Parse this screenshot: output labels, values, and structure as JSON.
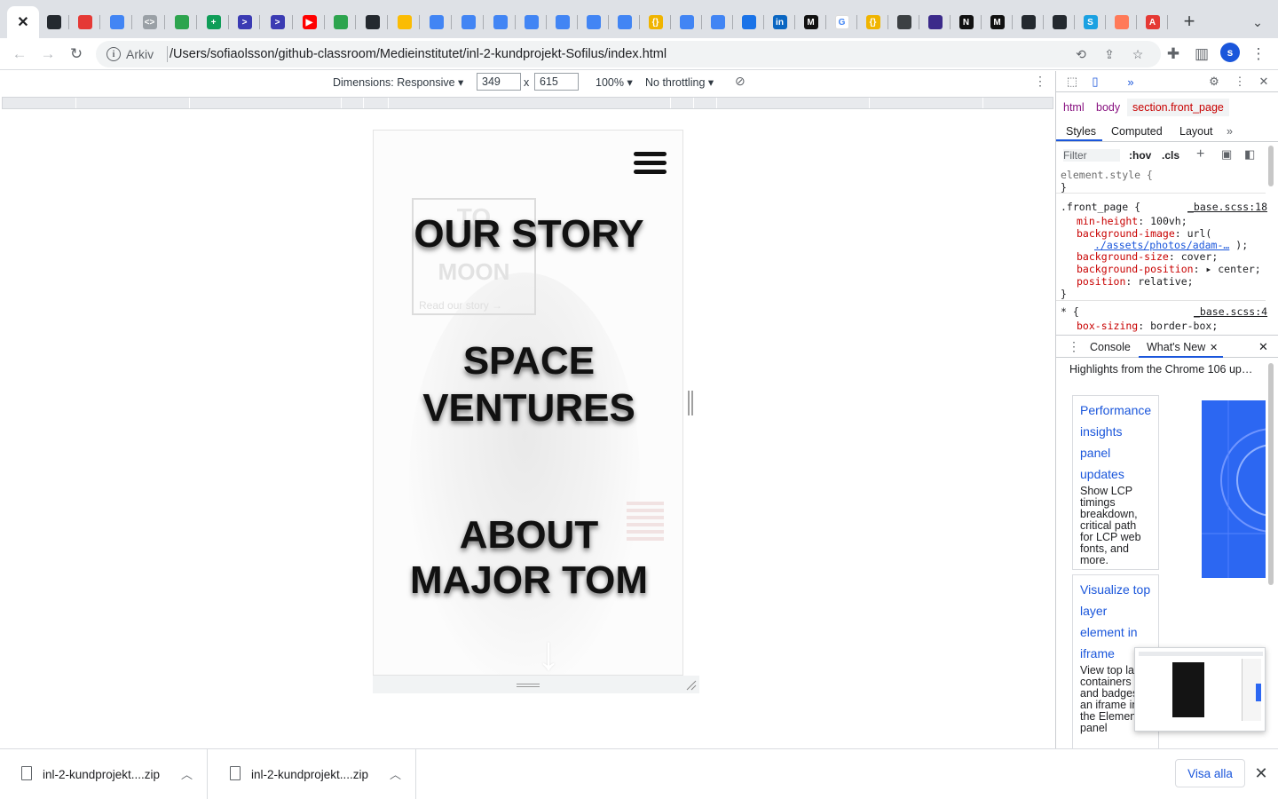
{
  "tabs": {
    "active_close": "✕",
    "favicons": [
      {
        "name": "github-icon",
        "color": "#24292f",
        "glyph": ""
      },
      {
        "name": "pin-icon",
        "color": "#e53935",
        "glyph": ""
      },
      {
        "name": "docs-icon",
        "color": "#4285f4",
        "glyph": ""
      },
      {
        "name": "code-icon",
        "color": "#9aa0a6",
        "glyph": "<>"
      },
      {
        "name": "github-icon",
        "color": "#2da44e",
        "glyph": ""
      },
      {
        "name": "sheets-icon",
        "color": "#0f9d58",
        "glyph": "+"
      },
      {
        "name": "prompt-icon",
        "color": "#3b3bb3",
        "glyph": ">"
      },
      {
        "name": "prompt-icon",
        "color": "#3b3bb3",
        "glyph": ">"
      },
      {
        "name": "youtube-icon",
        "color": "#ff0000",
        "glyph": "▶"
      },
      {
        "name": "github-icon",
        "color": "#2da44e",
        "glyph": ""
      },
      {
        "name": "github-icon",
        "color": "#24292f",
        "glyph": ""
      },
      {
        "name": "drive-icon",
        "color": "#fbbc04",
        "glyph": ""
      },
      {
        "name": "docs-icon",
        "color": "#4285f4",
        "glyph": ""
      },
      {
        "name": "docs-icon",
        "color": "#4285f4",
        "glyph": ""
      },
      {
        "name": "docs-icon",
        "color": "#4285f4",
        "glyph": ""
      },
      {
        "name": "docs-icon",
        "color": "#4285f4",
        "glyph": ""
      },
      {
        "name": "docs-icon",
        "color": "#4285f4",
        "glyph": ""
      },
      {
        "name": "docs-icon",
        "color": "#4285f4",
        "glyph": ""
      },
      {
        "name": "docs-icon",
        "color": "#4285f4",
        "glyph": ""
      },
      {
        "name": "json-icon",
        "color": "#f0b400",
        "glyph": "{}"
      },
      {
        "name": "docs-icon",
        "color": "#4285f4",
        "glyph": ""
      },
      {
        "name": "docs-icon",
        "color": "#4285f4",
        "glyph": ""
      },
      {
        "name": "window-icon",
        "color": "#1a73e8",
        "glyph": ""
      },
      {
        "name": "linkedin-icon",
        "color": "#0a66c2",
        "glyph": "in"
      },
      {
        "name": "medium-icon",
        "color": "#111111",
        "glyph": "M"
      },
      {
        "name": "google-icon",
        "color": "#ffffff",
        "glyph": "G"
      },
      {
        "name": "json-icon",
        "color": "#f0b400",
        "glyph": "{}"
      },
      {
        "name": "eraser-icon",
        "color": "#3c4043",
        "glyph": ""
      },
      {
        "name": "mascot-icon",
        "color": "#3b2a8a",
        "glyph": ""
      },
      {
        "name": "notion-icon",
        "color": "#111111",
        "glyph": "N"
      },
      {
        "name": "medium-icon",
        "color": "#111111",
        "glyph": "M"
      },
      {
        "name": "github-icon",
        "color": "#24292f",
        "glyph": ""
      },
      {
        "name": "github-icon",
        "color": "#24292f",
        "glyph": ""
      },
      {
        "name": "s-icon",
        "color": "#1ba1e2",
        "glyph": "S"
      },
      {
        "name": "orange-icon",
        "color": "#ff7a59",
        "glyph": ""
      },
      {
        "name": "red-icon",
        "color": "#e53935",
        "glyph": "A"
      }
    ],
    "new_tab": "+",
    "tab_search": "⌄"
  },
  "toolbar": {
    "scheme_label": "Arkiv",
    "url": "/Users/sofiaolsson/github-classroom/Medieinstitutet/inl-2-kundprojekt-Sofilus/index.html",
    "profile_initial": "s"
  },
  "device_toolbar": {
    "dimensions_label": "Dimensions: Responsive ▾",
    "width": "349",
    "times": "x",
    "height": "615",
    "zoom": "100% ▾",
    "throttling": "No throttling ▾"
  },
  "page": {
    "bg_box_top": "TO",
    "bg_box_bottom": "MOON",
    "bg_link": "Read our story →",
    "heading_1": "OUR STORY",
    "heading_2_line1": "SPACE",
    "heading_2_line2": "VENTURES",
    "heading_3_line1": "ABOUT",
    "heading_3_line2": "MAJOR TOM",
    "arrow": "↓"
  },
  "devtools": {
    "breadcrumbs": [
      "html",
      "body",
      "section.front_page"
    ],
    "style_tabs": [
      "Styles",
      "Computed",
      "Layout"
    ],
    "filter_placeholder": "Filter",
    "hov": ":hov",
    "cls": ".cls",
    "css": {
      "element_style": "element.style {",
      "close1": "}",
      "front_selector": ".front_page {",
      "front_source": "_base.scss:18",
      "min_height_p": "min-height",
      "min_height_v": ": 100vh;",
      "bg_image_p": "background-image",
      "bg_image_v": ": url(",
      "bg_image_link": "./assets/photos/adam-…",
      "bg_image_end": ");",
      "bg_size_p": "background-size",
      "bg_size_v": ": cover;",
      "bg_pos_p": "background-position",
      "bg_pos_v": ": ▸ center;",
      "position_p": "position",
      "position_v": ": relative;",
      "close2": "}",
      "star_selector": "* {",
      "star_source": "_base.scss:4",
      "box_sizing_p": "box-sizing",
      "box_sizing_v": ": border-box;"
    },
    "drawer_tabs": [
      "Console",
      "What's New"
    ],
    "whats_new_title": "Highlights from the Chrome 106 up…",
    "card1_title": "Performance insights panel updates",
    "card1_body": "Show LCP timings breakdown, critical path for LCP web fonts, and more.",
    "card2_title": "Visualize top layer element in iframe",
    "card2_body": "View top layer containers and badges of an iframe in the Elements panel"
  },
  "downloads": {
    "items": [
      "inl-2-kundprojekt....zip",
      "inl-2-kundprojekt....zip"
    ],
    "show_all": "Visa alla",
    "close": "✕"
  }
}
